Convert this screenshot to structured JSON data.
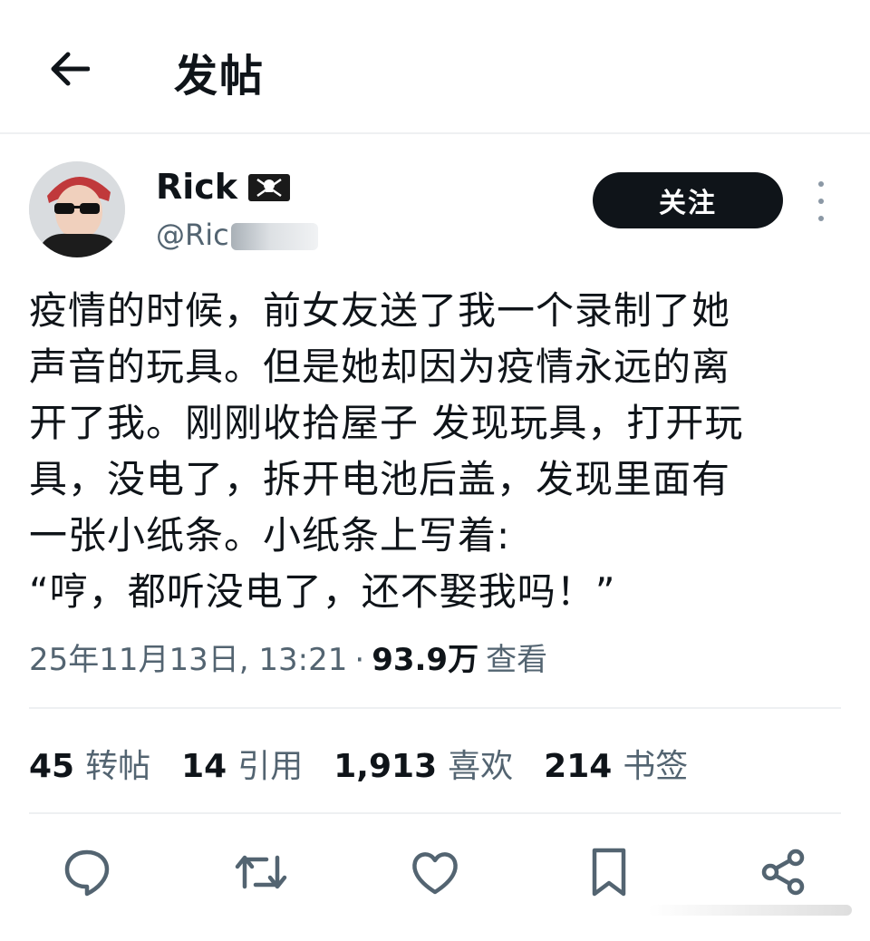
{
  "header": {
    "back_icon": "arrow-left-icon",
    "title": "发帖"
  },
  "author": {
    "display_name": "Rick",
    "flag_icon": "pirate-flag-icon",
    "handle": "@Ric"
  },
  "follow_button": {
    "label": "关注"
  },
  "more_icon": "more-vertical-icon",
  "post": {
    "text": "疫情的时候，前女友送了我一个录制了她\n声音的玩具。但是她却因为疫情永远的离\n开了我。刚刚收拾屋子 发现玩具，打开玩\n具，没电了，拆开电池后盖，发现里面有\n一张小纸条。小纸条上写着:\n“哼，都听没电了，还不娶我吗！”"
  },
  "meta": {
    "datetime": "25年11月13日, 13:21",
    "separator": "·",
    "views": "93.9万",
    "views_label": "查看"
  },
  "stats": [
    {
      "num": "45",
      "label": "转帖"
    },
    {
      "num": "14",
      "label": "引用"
    },
    {
      "num": "1,913",
      "label": "喜欢"
    },
    {
      "num": "214",
      "label": "书签"
    }
  ],
  "actions": [
    "reply-icon",
    "repost-icon",
    "like-icon",
    "bookmark-icon",
    "share-icon"
  ],
  "colors": {
    "primary_text": "#0f1419",
    "secondary_text": "#536471",
    "button_bg": "#0f1419",
    "divider": "#eef0f2"
  }
}
